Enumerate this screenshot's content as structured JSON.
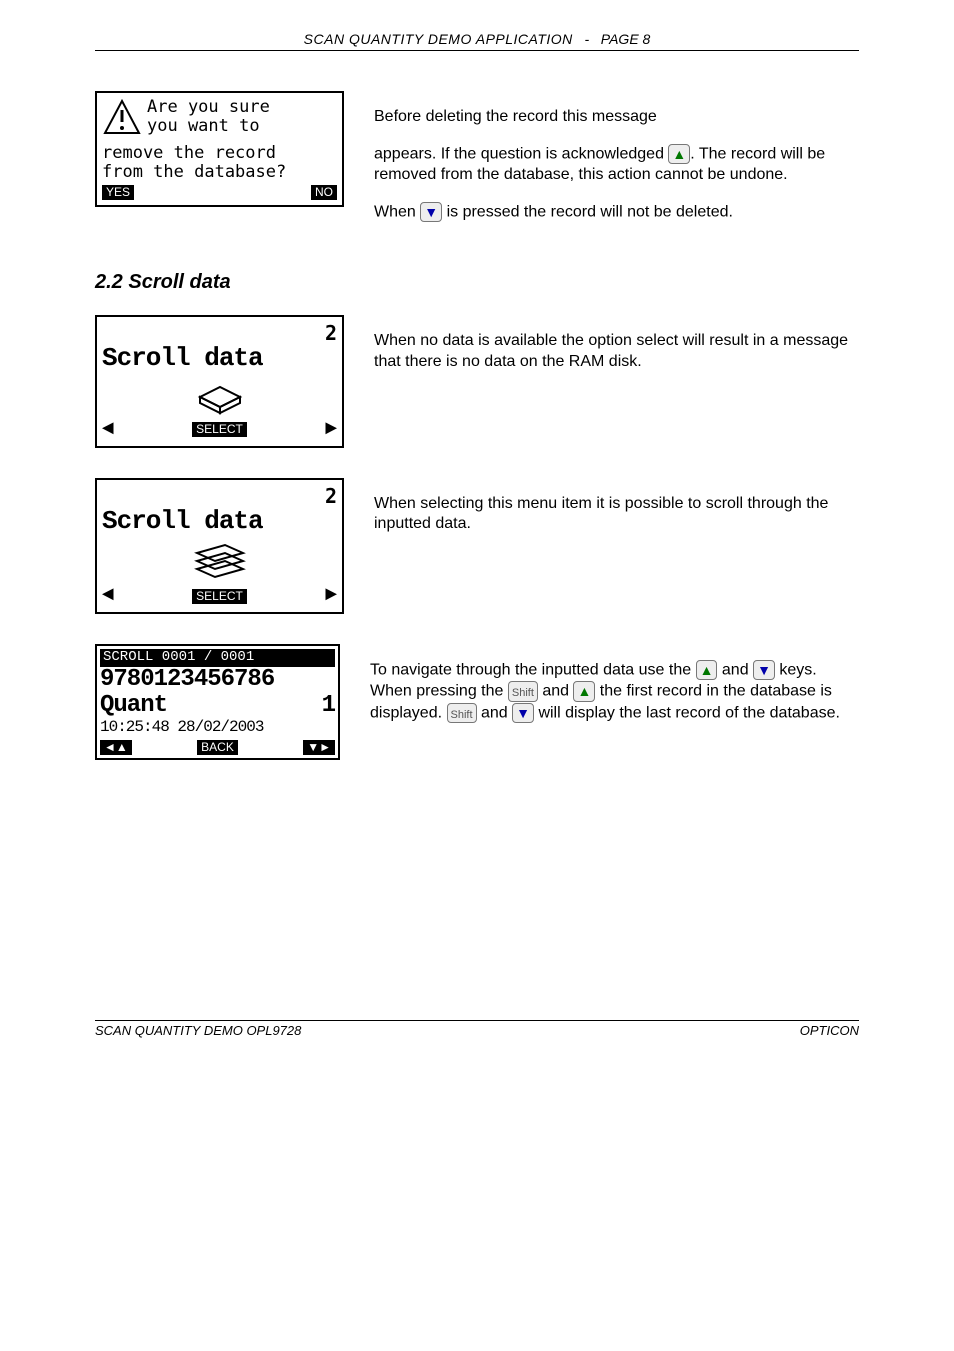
{
  "header": {
    "title_small": "SCAN QUANTITY DEMO APPLICATION",
    "dash": "-",
    "page_label": "PAGE 8"
  },
  "confirm_box": {
    "line1": "Are you sure",
    "line2": "you want to",
    "line3": "remove the record",
    "line4": "from the database?",
    "yes": "YES",
    "no": "NO"
  },
  "para_delete_1": "Before deleting the record this message",
  "para_delete_2a": "appears. If the question is acknowledged",
  "para_delete_2b": ". The record will be removed from the database, this action cannot be undone.",
  "para_delete_3a": "When",
  "para_delete_3b": "is pressed the record will not be deleted.",
  "section_2_2": "2.2    Scroll data",
  "scrollbox": {
    "num": "2",
    "title": "Scroll data",
    "select": "SELECT"
  },
  "para_nodata": "When no data is available the option select will result in a message that there is no data on the RAM disk.",
  "para_possible": "When selecting this menu item it is possible to scroll through the inputted data.",
  "detailbox": {
    "head": "SCROLL 0001 / 0001",
    "barcode": "9780123456786",
    "quant_label": "Quant",
    "quant_val": "1",
    "timestamp": "10:25:48 28/02/2003",
    "back": "BACK"
  },
  "para_nav_1": "To navigate through the inputted data use the",
  "para_nav_and1": "and",
  "para_nav_2": "keys. When pressing the",
  "para_nav_and2": "and",
  "para_nav_3": "the first record in the database is displayed.",
  "para_nav_and3": "and",
  "para_nav_4": "will display the last record of the database.",
  "footer": {
    "left": "SCAN QUANTITY DEMO OPL9728",
    "right": "OPTICON"
  }
}
